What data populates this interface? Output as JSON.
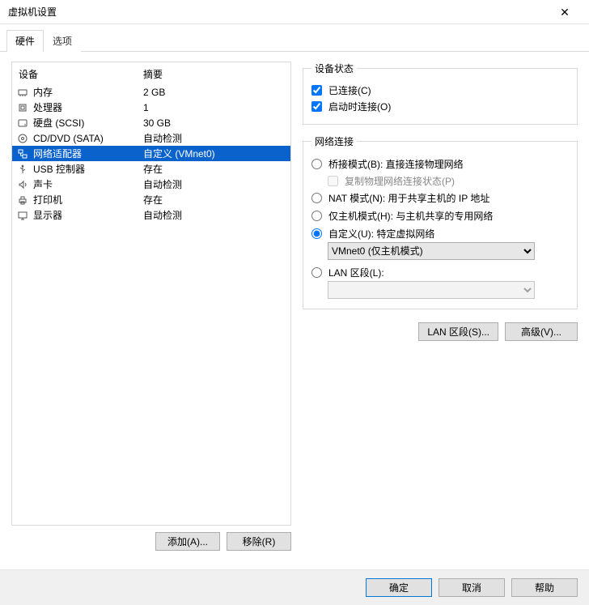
{
  "window": {
    "title": "虚拟机设置"
  },
  "tabs": {
    "hardware": "硬件",
    "options": "选项"
  },
  "columns": {
    "device": "设备",
    "summary": "摘要"
  },
  "devices": [
    {
      "icon": "memory-icon",
      "label": "内存",
      "summary": "2 GB"
    },
    {
      "icon": "cpu-icon",
      "label": "处理器",
      "summary": "1"
    },
    {
      "icon": "disk-icon",
      "label": "硬盘 (SCSI)",
      "summary": "30 GB"
    },
    {
      "icon": "disc-icon",
      "label": "CD/DVD (SATA)",
      "summary": "自动检测"
    },
    {
      "icon": "network-icon",
      "label": "网络适配器",
      "summary": "自定义 (VMnet0)",
      "selected": true
    },
    {
      "icon": "usb-icon",
      "label": "USB 控制器",
      "summary": "存在"
    },
    {
      "icon": "sound-icon",
      "label": "声卡",
      "summary": "自动检测"
    },
    {
      "icon": "printer-icon",
      "label": "打印机",
      "summary": "存在"
    },
    {
      "icon": "display-icon",
      "label": "显示器",
      "summary": "自动检测"
    }
  ],
  "buttons": {
    "add": "添加(A)...",
    "remove": "移除(R)"
  },
  "status_group": {
    "legend": "设备状态",
    "connected": "已连接(C)",
    "connect_at_power_on": "启动时连接(O)"
  },
  "network_group": {
    "legend": "网络连接",
    "bridged": "桥接模式(B): 直接连接物理网络",
    "replicate": "复制物理网络连接状态(P)",
    "nat": "NAT 模式(N): 用于共享主机的 IP 地址",
    "hostonly": "仅主机模式(H): 与主机共享的专用网络",
    "custom": "自定义(U): 特定虚拟网络",
    "custom_value": "VMnet0 (仅主机模式)",
    "lan_segment": "LAN 区段(L):",
    "lan_segment_value": ""
  },
  "right_buttons": {
    "lan_segments": "LAN 区段(S)...",
    "advanced": "高级(V)..."
  },
  "dialog_buttons": {
    "ok": "确定",
    "cancel": "取消",
    "help": "帮助"
  }
}
